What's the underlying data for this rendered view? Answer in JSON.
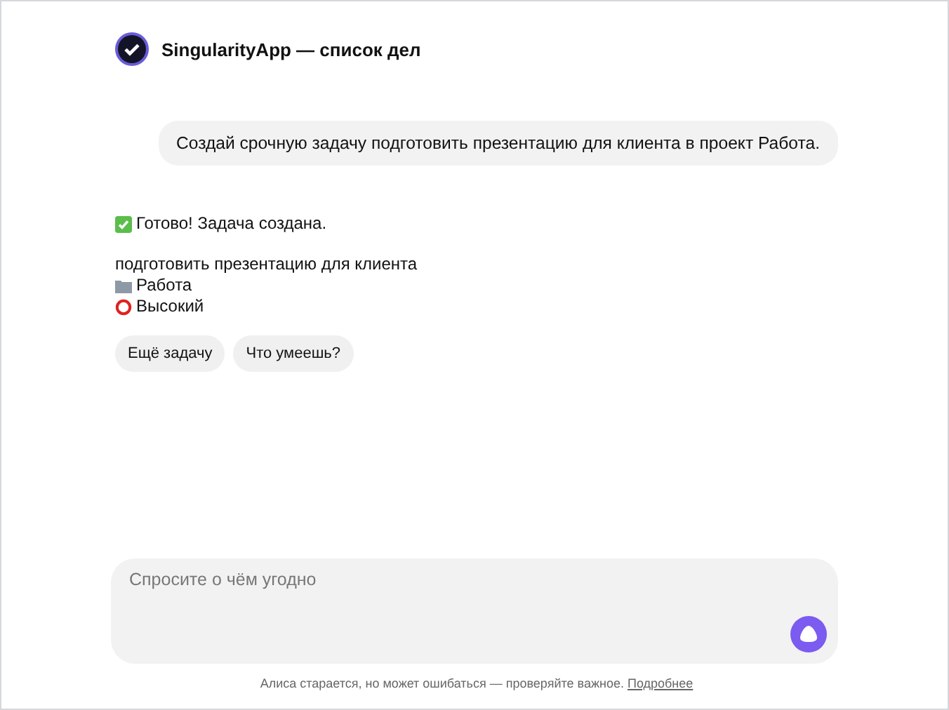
{
  "header": {
    "title": "SingularityApp — список дел"
  },
  "user_message": "Создай срочную задачу подготовить презентацию для клиента в проект Работа.",
  "reply": {
    "status": {
      "kind": "done",
      "text": "Готово! Задача создана."
    },
    "lines": [
      {
        "kind": "plain",
        "text": "подготовить презентацию для клиента"
      },
      {
        "kind": "project",
        "text": "Работа"
      },
      {
        "kind": "priority",
        "text": "Высокий"
      }
    ]
  },
  "suggestions": [
    "Ещё задачу",
    "Что умеешь?"
  ],
  "input": {
    "placeholder": "Спросите о чём угодно"
  },
  "footer": {
    "text": "Алиса старается, но может ошибаться — проверяйте важное.",
    "link": "Подробнее"
  }
}
